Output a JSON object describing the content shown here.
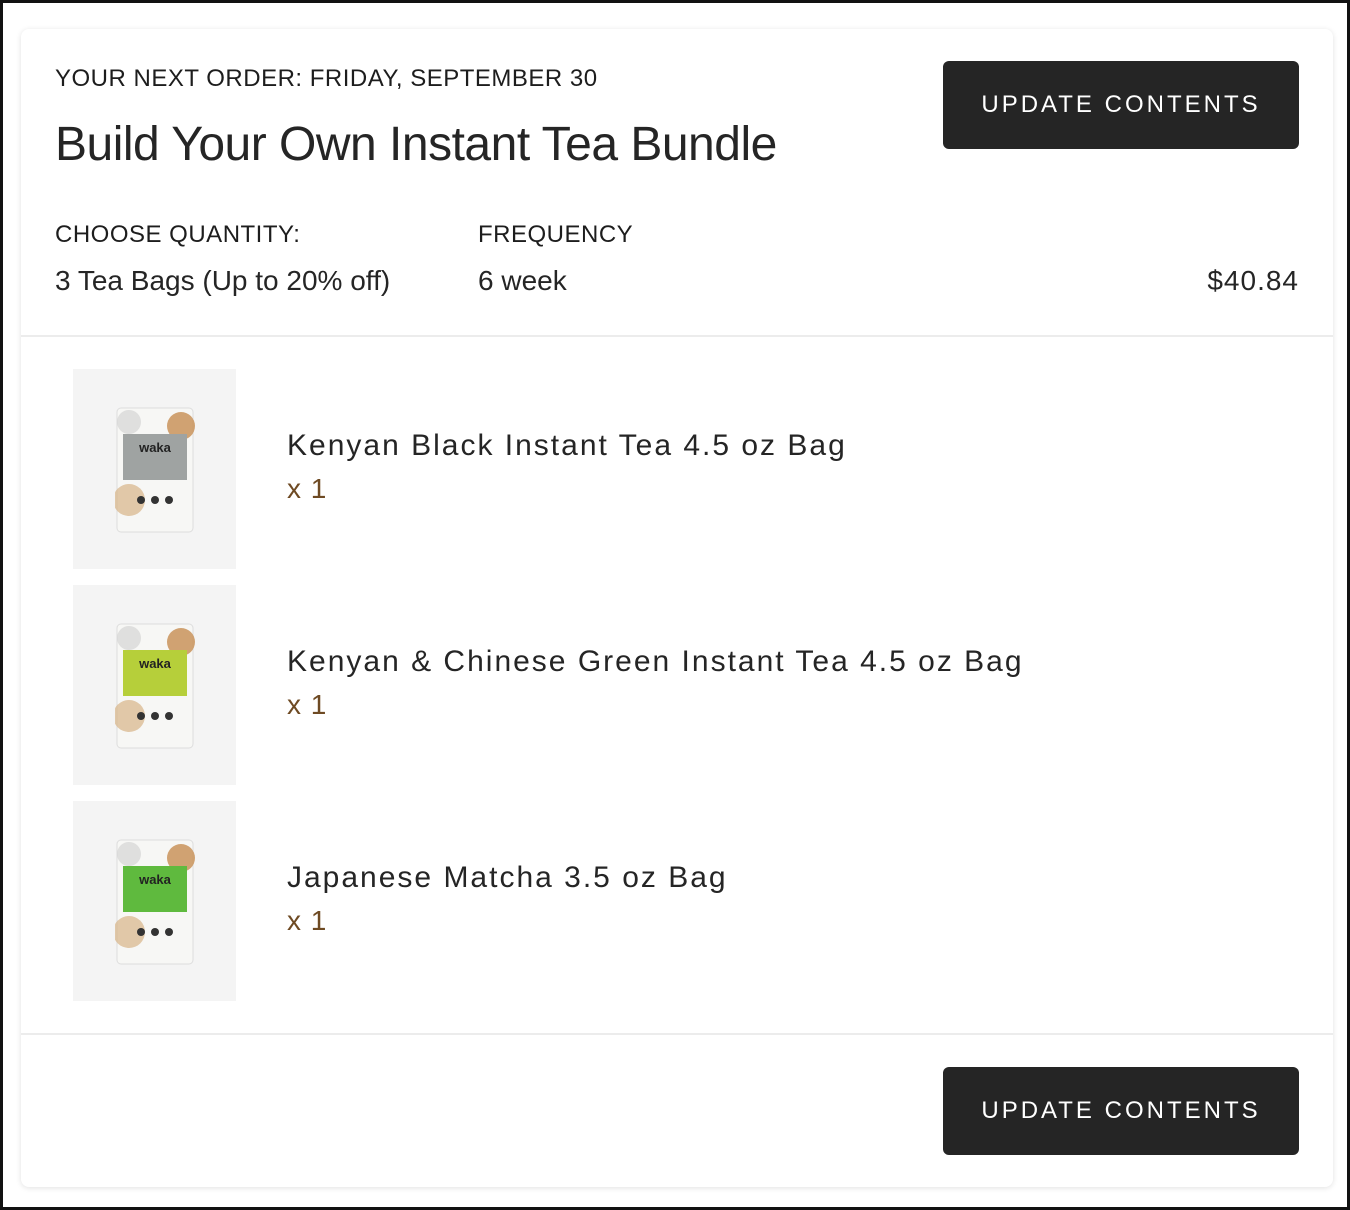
{
  "order": {
    "next_order": "YOUR NEXT ORDER: FRIDAY, SEPTEMBER 30",
    "title": "Build Your Own Instant Tea Bundle",
    "update_button": "UPDATE CONTENTS",
    "quantity_label": "CHOOSE QUANTITY:",
    "quantity_value": "3 Tea Bags (Up to 20% off)",
    "frequency_label": "FREQUENCY",
    "frequency_value": "6 week",
    "price": "$40.84"
  },
  "items": [
    {
      "name": "Kenyan Black Instant Tea 4.5 oz Bag",
      "qty": "x 1",
      "bag_color": "#9fa3a2",
      "brand": "waka"
    },
    {
      "name": "Kenyan & Chinese Green Instant Tea 4.5 oz Bag",
      "qty": "x 1",
      "bag_color": "#b6cf3a",
      "brand": "waka"
    },
    {
      "name": "Japanese Matcha 3.5 oz Bag",
      "qty": "x 1",
      "bag_color": "#5fba3e",
      "brand": "waka"
    }
  ],
  "footer": {
    "update_button": "UPDATE CONTENTS"
  },
  "colors": {
    "button_bg": "#252525",
    "qty_text": "#6e4a23"
  }
}
